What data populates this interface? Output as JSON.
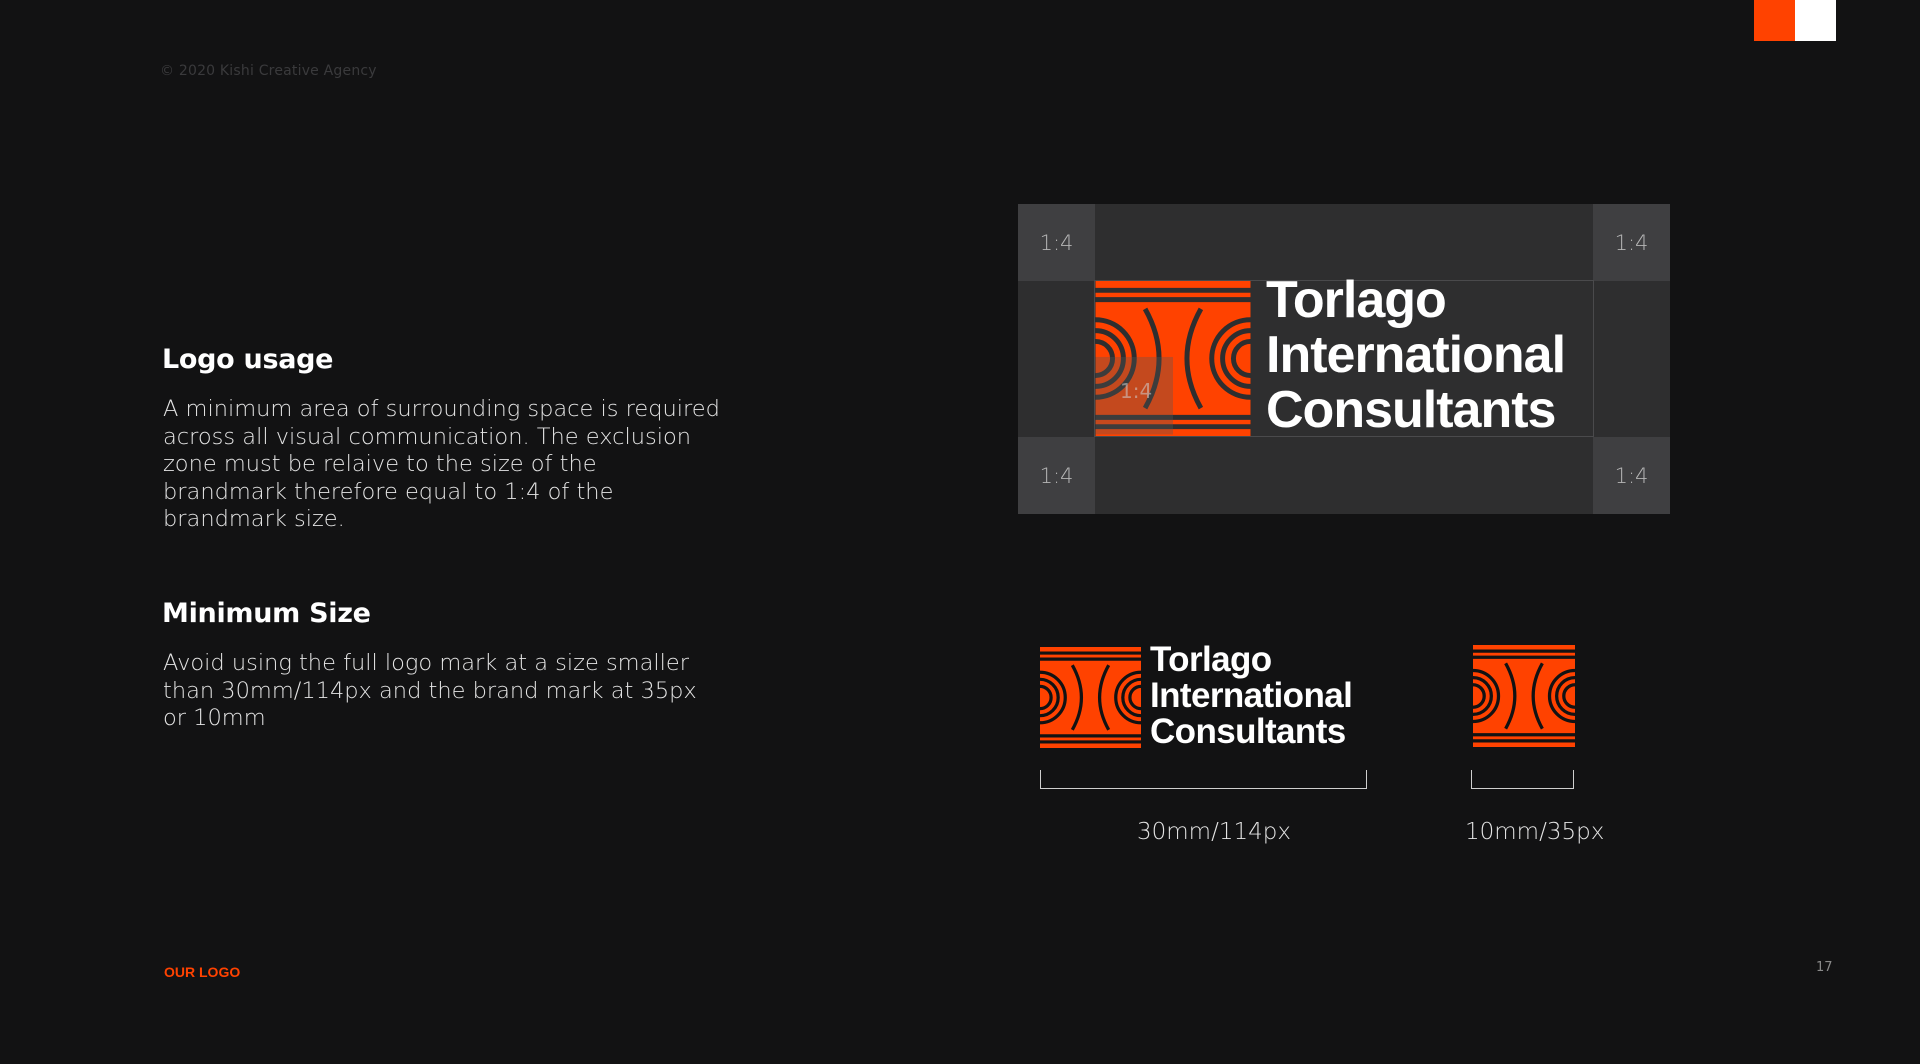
{
  "header": {
    "copyright": "© 2020  Kishi Creative Agency"
  },
  "logo_usage": {
    "title": "Logo usage",
    "body": "A minimum area of surrounding space is required across all visual communication. The exclusion zone must be relaive to the size of the brandmark therefore equal to 1:4 of the brandmark size."
  },
  "minimum_size": {
    "title": "Minimum Size",
    "body": "Avoid using the  full logo mark at a size smaller than 30mm/114px and the brand mark at 35px or 10mm"
  },
  "exclusion_zone": {
    "corner_label": "1:4",
    "mark_label": "1:4"
  },
  "brand": {
    "line1": "Torlago",
    "line2": "International",
    "line3": "Consultants"
  },
  "sizes": {
    "full_logo": "30mm/114px",
    "brand_mark": "10mm/35px"
  },
  "footer": {
    "section": "OUR LOGO",
    "page_number": "17"
  },
  "colors": {
    "accent": "#ff4200",
    "background": "#121213",
    "zone": "#2e2e2f",
    "zone_corner": "#3f3f41"
  }
}
